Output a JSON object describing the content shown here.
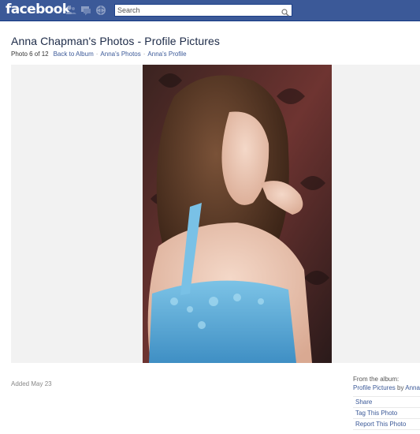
{
  "header": {
    "logo": "facebook",
    "search_placeholder": "Search",
    "brand_color": "#3b5998",
    "jewels": [
      "friend-requests-icon",
      "messages-icon",
      "notifications-icon"
    ]
  },
  "page": {
    "title": "Anna Chapman's Photos - Profile Pictures",
    "photo_count": "Photo 6 of 12",
    "links": [
      "Back to Album",
      "Anna's Photos",
      "Anna's Profile"
    ],
    "separator": "·"
  },
  "photo": {
    "description": "portrait photo"
  },
  "footer": {
    "added": "Added May 23",
    "from_album": "From the album:",
    "album_name": "Profile Pictures",
    "by": "by",
    "owner": "Anna",
    "actions": [
      "Share",
      "Tag This Photo",
      "Report This Photo"
    ]
  }
}
